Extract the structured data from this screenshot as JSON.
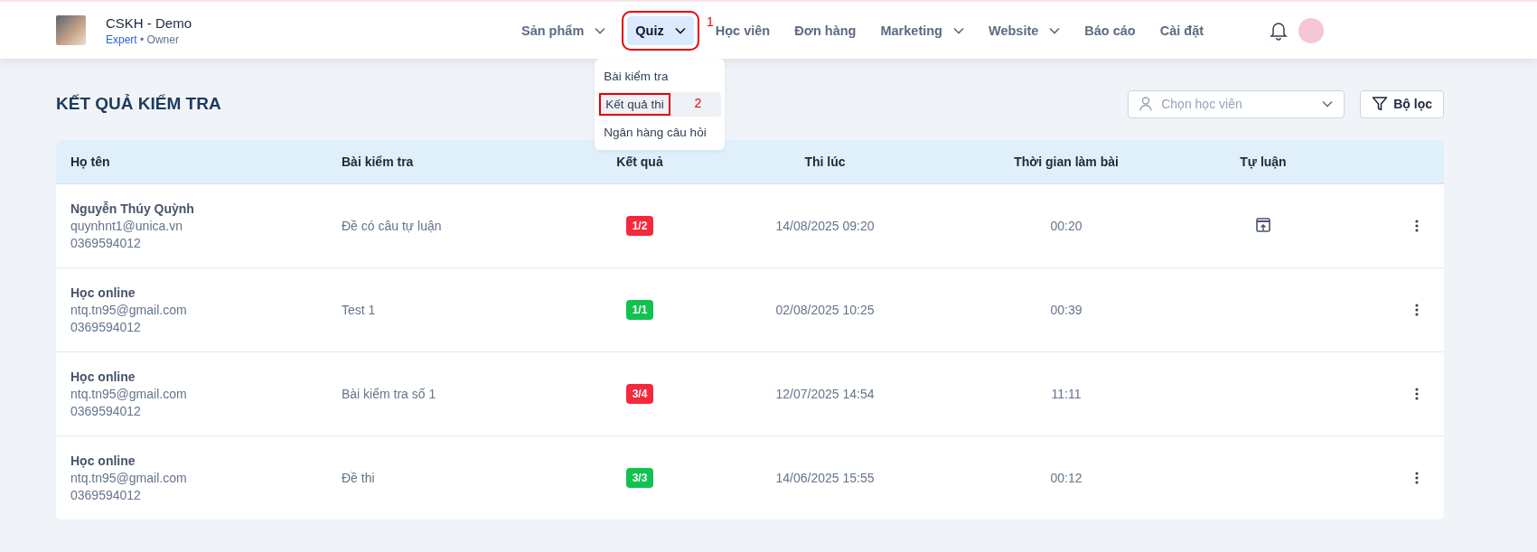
{
  "header": {
    "brand": {
      "title": "CSKH - Demo",
      "plan": "Expert",
      "role": "• Owner"
    },
    "nav": [
      {
        "label": "Sản phẩm",
        "has_menu": true,
        "selected": false
      },
      {
        "label": "Quiz",
        "has_menu": true,
        "selected": true,
        "annotation": "1"
      },
      {
        "label": "Học viên",
        "has_menu": false,
        "selected": false
      },
      {
        "label": "Đơn hàng",
        "has_menu": false,
        "selected": false
      },
      {
        "label": "Marketing",
        "has_menu": true,
        "selected": false
      },
      {
        "label": "Website",
        "has_menu": true,
        "selected": false
      },
      {
        "label": "Báo cáo",
        "has_menu": false,
        "selected": false
      },
      {
        "label": "Cài đặt",
        "has_menu": false,
        "selected": false
      }
    ],
    "quiz_menu": [
      {
        "label": "Bài kiểm tra",
        "selected": false
      },
      {
        "label": "Kết quả thi",
        "selected": true,
        "annotation": "2"
      },
      {
        "label": "Ngân hàng câu hỏi",
        "selected": false
      }
    ]
  },
  "page": {
    "title": "KẾT QUẢ KIỂM TRA",
    "student_select": {
      "placeholder": "Chọn học viên"
    },
    "filter_button": "Bộ lọc"
  },
  "table": {
    "columns": [
      "Họ tên",
      "Bài kiểm tra",
      "Kết quả",
      "Thi lúc",
      "Thời gian làm bài",
      "Tự luận"
    ],
    "rows": [
      {
        "name": "Nguyễn Thúy Quỳnh",
        "email": "quynhnt1@unica.vn",
        "phone": "0369594012",
        "test": "Đề có câu tự luận",
        "result": "1/2",
        "color": "#f5283c",
        "taken_at": "14/08/2025 09:20",
        "duration": "00:20",
        "has_essay": true
      },
      {
        "name": "Học online",
        "email": "ntq.tn95@gmail.com",
        "phone": "0369594012",
        "test": "Test 1",
        "result": "1/1",
        "color": "#12c24f",
        "taken_at": "02/08/2025 10:25",
        "duration": "00:39",
        "has_essay": false
      },
      {
        "name": "Học online",
        "email": "ntq.tn95@gmail.com",
        "phone": "0369594012",
        "test": "Bài kiểm tra số 1",
        "result": "3/4",
        "color": "#f5283c",
        "taken_at": "12/07/2025 14:54",
        "duration": "11:11",
        "has_essay": false
      },
      {
        "name": "Học online",
        "email": "ntq.tn95@gmail.com",
        "phone": "0369594012",
        "test": "Đề thi",
        "result": "3/3",
        "color": "#12c24f",
        "taken_at": "14/06/2025 15:55",
        "duration": "00:12",
        "has_essay": false
      }
    ]
  }
}
